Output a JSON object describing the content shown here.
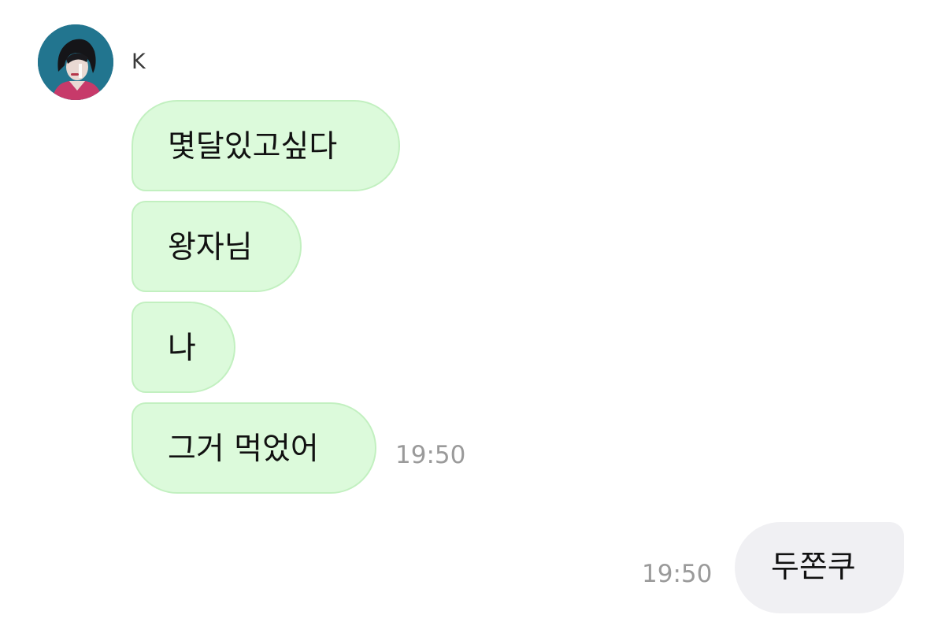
{
  "chat": {
    "sender": {
      "name": "K",
      "avatar": "profile-photo"
    },
    "incoming": [
      {
        "text": "몇달있고싶다"
      },
      {
        "text": "왕자님"
      },
      {
        "text": "나"
      },
      {
        "text": "그거 먹었어"
      }
    ],
    "incoming_time": "19:50",
    "outgoing": [
      {
        "text": "두쫀쿠"
      }
    ],
    "outgoing_time": "19:50"
  },
  "colors": {
    "incoming_bubble": "#dcfadb",
    "incoming_border": "#c2f0c0",
    "outgoing_bubble": "#f0f0f3",
    "timestamp": "#9a9a9a"
  }
}
